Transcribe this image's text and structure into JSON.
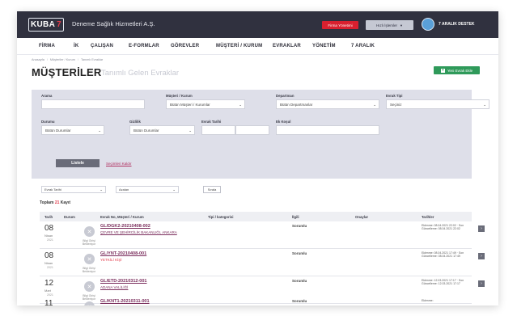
{
  "app": {
    "logo_text": "KUBA",
    "logo_num": "7",
    "company": "Deneme Sağlık Hizmetleri A.Ş.",
    "firma_button": "Firma Yönetimi",
    "hizli_button": "Hızlı İşlemler",
    "user": "7 ARALIK DESTEK",
    "accent": "#e23a4a",
    "topbar_bg": "#30313f",
    "new_button_bg": "#2f9a5a"
  },
  "nav": [
    "FİRMA",
    "İK",
    "ÇALIŞAN",
    "E-FORMLAR",
    "GÖREVLER",
    "MÜŞTERİ / KURUM",
    "EVRAKLAR",
    "YÖNETİM",
    "7 ARALIK"
  ],
  "breadcrumb": [
    "Anasayfa",
    "Müşteriler / Kurum",
    "Tanımlı Evraklar"
  ],
  "page": {
    "title": "MÜŞTERİLER",
    "subtitle": "Tanımlı Gelen Evraklar",
    "new_button": "Yeni Evrak Ekle"
  },
  "filters": {
    "arama_label": "Arama",
    "arama_value": "",
    "musteri_label": "Müşteri / Kurum",
    "musteri_value": "Bütün Müşteri / Kurumlar",
    "departman_label": "Departman",
    "departman_value": "Bütün Departmanlar",
    "evrak_tipi_label": "Evrak Tipi",
    "evrak_tipi_value": "Seçiniz",
    "durumu_label": "Durumu",
    "durumu_value": "Bütün Durumlar",
    "gizlilik_label": "Gizlilik",
    "gizlilik_value": "Bütün Durumlar",
    "evrak_tarihi_label": "Evrak Tarihi",
    "ek_kosul_label": "Ek Koşul",
    "listele_button": "Listele",
    "clear_link": "Seçimleri Kaldır"
  },
  "results": {
    "sort_field": "Evrak Tarihi",
    "sort_order": "Azalan",
    "sort_button": "Sırala",
    "total_prefix": "Toplam",
    "total_count": "21",
    "total_suffix": "Kayıt",
    "columns": [
      "Tarih",
      "Durum",
      "Evrak No, Müşteri / Kurum",
      "Tipi / kategorisi",
      "İlgili",
      "Onaylar",
      "Tarihler"
    ],
    "rows": [
      {
        "day": "08",
        "month": "Nisan",
        "year": "2021",
        "status_icon": "x",
        "status": "Bilgi Girişi Bekleniyor",
        "doc_no": "GL/DGK2-20210408-002",
        "org": "ÇEVRE VE ŞEHİRCİLİK BAKANLIĞI, ANKARA",
        "org_style": "link",
        "ilgili": "Sorumlu",
        "dates": "Eklenme: 08.04.2021 22:02 · Son Güncelleme: 08.04.2021 22:02"
      },
      {
        "day": "08",
        "month": "Nisan",
        "year": "2021",
        "status_icon": "x",
        "status": "Bilgi Girişi Bekleniyor",
        "doc_no": "GL/YNT-20210408-001",
        "org": "YETKİLİ KİŞİ",
        "org_style": "red",
        "ilgili": "Sorumlu",
        "dates": "Eklenme: 08.04.2021 17:49 · Son Güncelleme: 08.04.2021 17:49"
      },
      {
        "day": "12",
        "month": "Mart",
        "year": "2021",
        "status_icon": "x",
        "status": "Bilgi Girişi Bekleniyor",
        "doc_no": "GL/ETD-20210312-001",
        "org": "ADANA VALİLİĞİ",
        "org_style": "link",
        "ilgili": "Sorumlu",
        "dates": "Eklenme: 12.03.2021 17:17 · Son Güncelleme: 12.03.2021 17:17"
      },
      {
        "day": "11",
        "month": "Mart",
        "year": "2021",
        "status_icon": "x",
        "status": "",
        "doc_no": "GL/KNT1-20210311-001",
        "org": "",
        "org_style": "link",
        "ilgili": "Sorumlu",
        "dates": "Eklenme:"
      }
    ]
  }
}
